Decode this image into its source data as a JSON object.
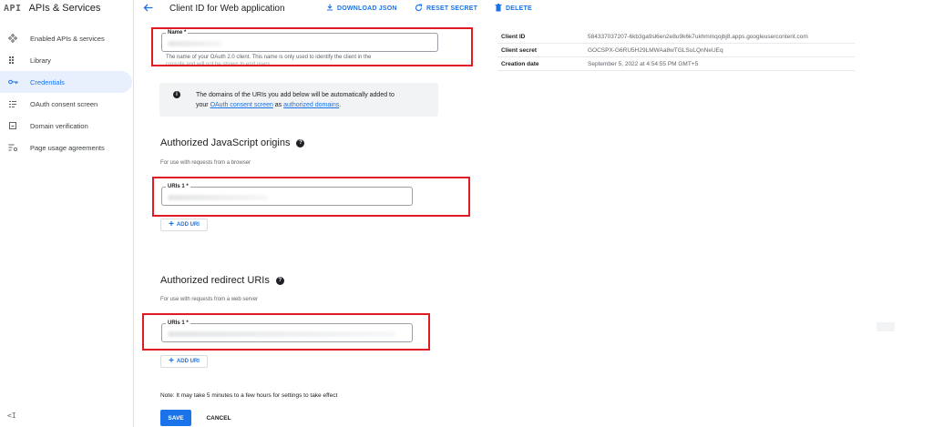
{
  "sidebar": {
    "logo": "API",
    "title": "APIs & Services",
    "items": [
      {
        "label": "Enabled APIs & services",
        "icon": "diamond-grid-icon"
      },
      {
        "label": "Library",
        "icon": "library-icon"
      },
      {
        "label": "Credentials",
        "icon": "key-icon",
        "active": true
      },
      {
        "label": "OAuth consent screen",
        "icon": "oauth-consent-icon"
      },
      {
        "label": "Domain verification",
        "icon": "checkbox-icon"
      },
      {
        "label": "Page usage agreements",
        "icon": "settings-list-icon"
      }
    ],
    "collapse_label": "<I"
  },
  "header": {
    "title": "Client ID for Web application",
    "download_label": "DOWNLOAD JSON",
    "reset_label": "RESET SECRET",
    "delete_label": "DELETE"
  },
  "form": {
    "name_label": "Name *",
    "name_hint_line1": "The name of your OAuth 2.0 client. This name is only used to identify the client in the",
    "name_hint_line2": "console and will not be shown to end users.",
    "info_text_line1": "The domains of the URIs you add below will be automatically added to",
    "info_text_your": "your ",
    "info_link_consent": "OAuth consent screen",
    "info_text_as": " as ",
    "info_link_domains": "authorized domains",
    "info_text_end": ".",
    "js_origins_title": "Authorized JavaScript origins",
    "js_origins_sub": "For use with requests from a browser",
    "js_uri_label": "URIs 1 *",
    "add_uri_label": "ADD URI",
    "redirect_title": "Authorized redirect URIs",
    "redirect_sub": "For use with requests from a web server",
    "redirect_uri_label": "URIs 1 *",
    "note": "Note: It may take 5 minutes to a few hours for settings to take effect",
    "save_label": "SAVE",
    "cancel_label": "CANCEL"
  },
  "client_info": [
    {
      "key": "Client ID",
      "value": "584337037207-6kb3ga9sl6en2e8u9k6k7ukhmmqojbj8.apps.googleusercontent.com"
    },
    {
      "key": "Client secret",
      "value": "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"
    },
    {
      "key": "Creation date",
      "value": "September 5, 2022 at 4:54:55 PM GMT+5"
    }
  ],
  "colors": {
    "accent": "#1a73e8",
    "highlight": "#e01b24"
  }
}
